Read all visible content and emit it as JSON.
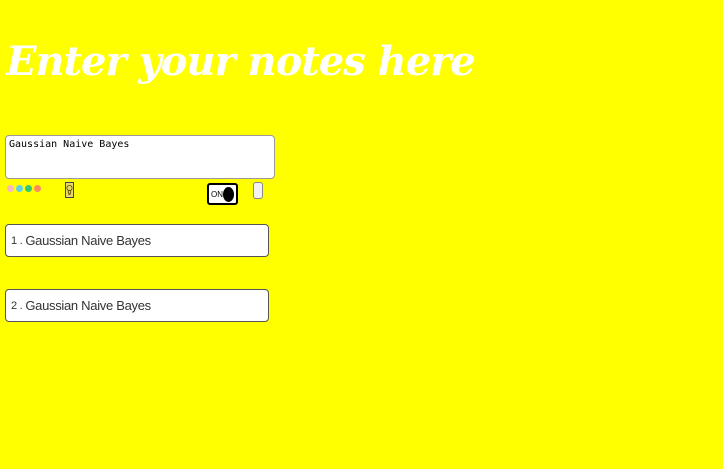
{
  "header": {
    "title": "Enter your notes here"
  },
  "editor": {
    "value": "Gaussian Naive Bayes"
  },
  "colors": {
    "palette": [
      "#f7b7c3",
      "#5fd0e6",
      "#34c96a",
      "#ff8a5c"
    ],
    "background": "#ffff00"
  },
  "controls": {
    "toggle_label": "ON",
    "bulb_icon": "lightbulb-icon"
  },
  "notes": [
    {
      "number": "1 .",
      "text": "Gaussian Naive Bayes"
    },
    {
      "number": "2 .",
      "text": "Gaussian Naive Bayes"
    }
  ]
}
